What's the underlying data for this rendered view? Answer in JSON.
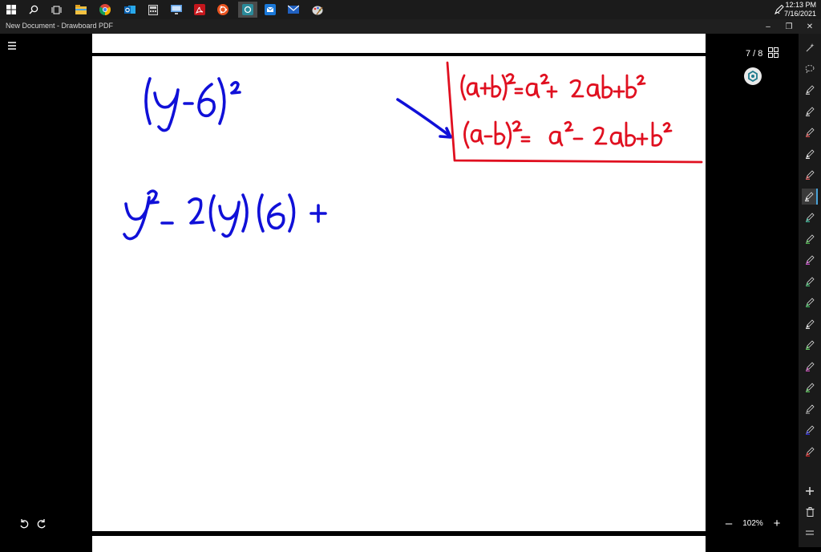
{
  "taskbar": {
    "icons": [
      "windows-start-icon",
      "search-icon",
      "task-view-icon",
      "file-explorer-icon",
      "chrome-icon",
      "outlook-icon",
      "calculator-icon",
      "remote-desktop-icon",
      "acrobat-icon",
      "ubuntu-icon",
      "drawboard-icon",
      "mail-icon",
      "mail-client-icon",
      "paint-icon"
    ],
    "clock": {
      "time": "12:13 PM",
      "date": "7/16/2021"
    }
  },
  "window": {
    "title": "New Document - Drawboard PDF",
    "minimize": "–",
    "restore": "❐",
    "close": "✕"
  },
  "viewer": {
    "page_indicator": "7 / 8",
    "zoom_minus": "–",
    "zoom_level": "102%",
    "zoom_plus": "+"
  },
  "ink_colors": {
    "blue": "#1010d8",
    "red": "#e01020"
  },
  "tools": {
    "pens": [
      {
        "color": "#c9c9c9"
      },
      {
        "color": "#c9c9c9"
      },
      {
        "color": "#e05050"
      },
      {
        "color": "#f2f2f2"
      },
      {
        "color": "#e86060"
      },
      {
        "color": "#f5f5f5"
      },
      {
        "color": "#3cc0a0"
      },
      {
        "color": "#50c050"
      },
      {
        "color": "#d050d0"
      },
      {
        "color": "#40c070"
      },
      {
        "color": "#40c060"
      },
      {
        "color": "#e8e8e8"
      },
      {
        "color": "#60d060"
      },
      {
        "color": "#d050c0"
      },
      {
        "color": "#60d060"
      },
      {
        "color": "#8a8a8a"
      },
      {
        "color": "#3030e0"
      },
      {
        "color": "#e02020"
      }
    ]
  }
}
